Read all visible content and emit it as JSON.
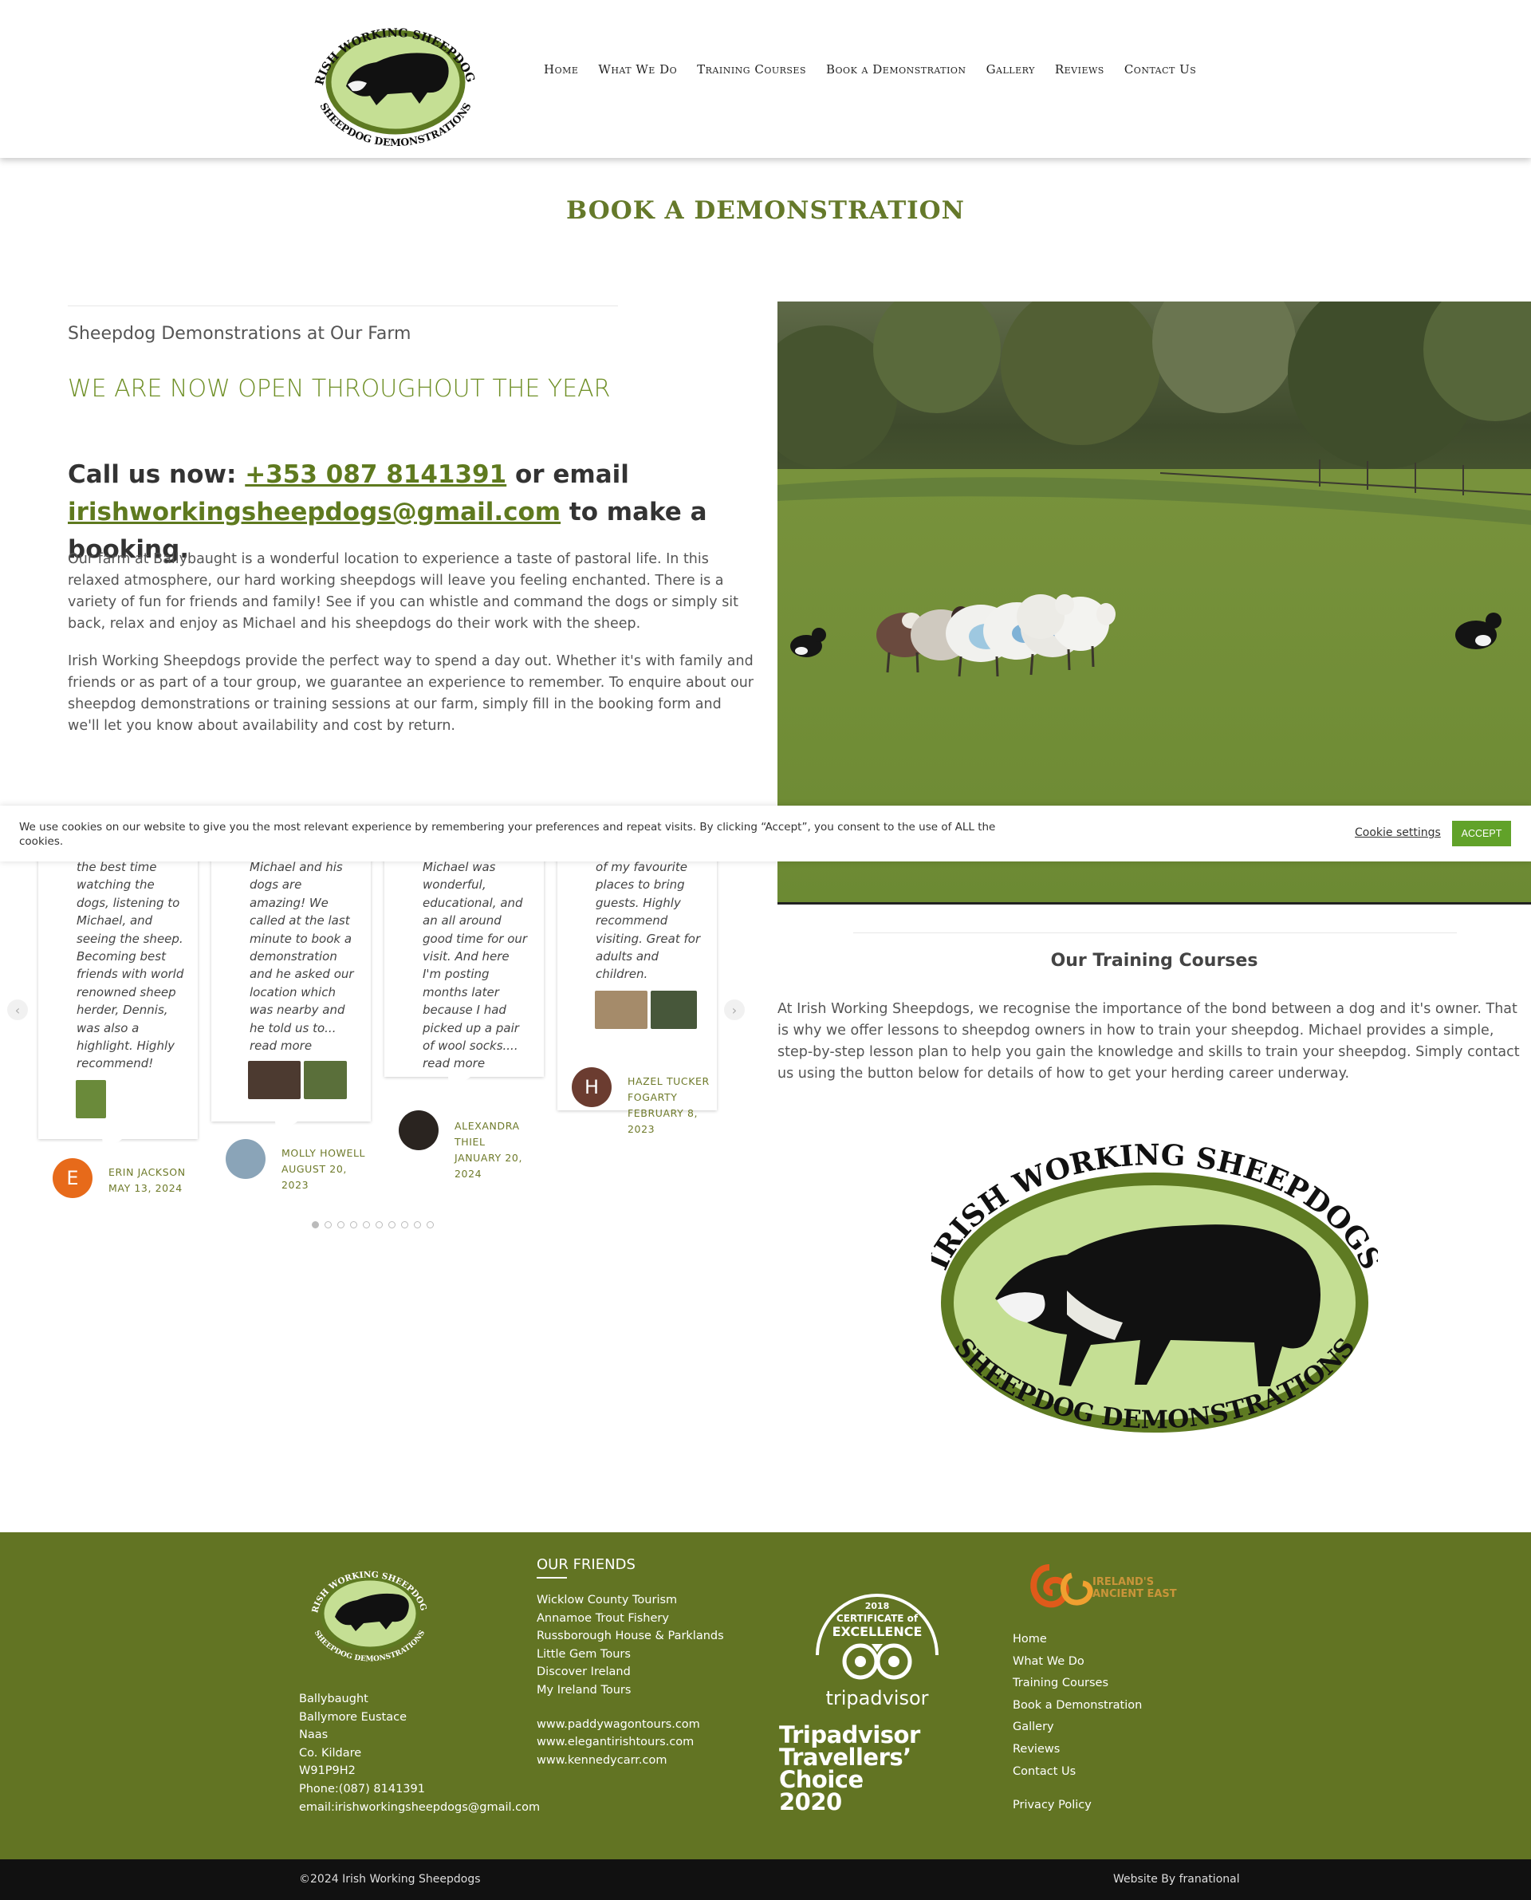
{
  "header": {
    "logo_top_text": "IRISH WORKING SHEEPDOGS",
    "logo_bottom_text": "SHEEPDOG DEMONSTRATIONS",
    "nav": [
      "Home",
      "What We Do",
      "Training Courses",
      "Book a Demonstration",
      "Gallery",
      "Reviews",
      "Contact Us"
    ]
  },
  "page_title": "BOOK A DEMONSTRATION",
  "intro": {
    "subhead": "Sheepdog Demonstrations at Our Farm",
    "open_banner": "WE ARE NOW OPEN THROUGHOUT THE YEAR",
    "call_prefix": "Call us now: ",
    "phone": "+353 087 8141391",
    "call_middle": " or email ",
    "email": "irishworkingsheepdogs@gmail.com",
    "call_suffix": " to make a booking.",
    "para1": "Our farm at Ballybaught is a wonderful location to experience a taste of pastoral life. In this relaxed atmosphere, our hard working sheepdogs will leave you feeling enchanted. There is a variety of fun for friends and family! See if you can whistle and command the dogs or simply sit back, relax and enjoy as Michael and his sheepdogs do their work with the sheep.",
    "para2": "Irish Working Sheepdogs provide the perfect way to spend a day out. Whether it's with family and friends or as part of a tour group, we guarantee an experience to remember. To enquire about our sheepdog demonstrations or training sessions at our farm, simply fill in the booking form and we'll let you know about availability and cost by return."
  },
  "cookie": {
    "text": "We use cookies on our website to give you the most relevant experience by remembering your preferences and repeat visits. By clicking “Accept”, you consent to the use of ALL the cookies.",
    "settings_label": "Cookie settings",
    "accept_label": "ACCEPT"
  },
  "reviews": [
    {
      "text": [
        "the best time",
        "watching the",
        "dogs, listening to",
        "Michael, and",
        "seeing the sheep.",
        "Becoming best",
        "friends with world",
        "renowned sheep",
        "herder, Dennis,",
        "was also a",
        "highlight. Highly",
        "recommend!"
      ],
      "initial": "E",
      "name": "ERIN JACKSON",
      "date": "MAY 13, 2024"
    },
    {
      "text": [
        "Michael and his",
        "dogs are",
        "amazing! We",
        "called at the last",
        "minute to book a",
        "demonstration",
        "and he asked our",
        "location which",
        "was nearby and",
        "he told us to...",
        "read more"
      ],
      "name": "MOLLY HOWELL",
      "date": "AUGUST 20, 2023"
    },
    {
      "text": [
        "Michael was",
        "wonderful,",
        "educational, and",
        "an all around",
        "good time for our",
        "visit. And here",
        "I'm posting",
        "months later",
        "because I had",
        "picked up a pair",
        "of wool socks....",
        "read more"
      ],
      "name": "ALEXANDRA THIEL",
      "date": "JANUARY 20, 2024"
    },
    {
      "text": [
        "of my favourite",
        "places to bring",
        "guests. Highly",
        "recommend",
        "visiting. Great for",
        "adults and",
        "children."
      ],
      "initial": "H",
      "name": "HAZEL TUCKER FOGARTY",
      "date": "FEBRUARY 8, 2023"
    }
  ],
  "carousel": {
    "prev_icon": "‹",
    "next_icon": "›",
    "dot_count": 10,
    "active_dot": 0
  },
  "training": {
    "title": "Our Training Courses",
    "text": "At Irish Working Sheepdogs, we recognise the importance of the bond between a dog and it's owner. That is why we offer lessons to sheepdog owners in how to train your sheepdog. Michael provides a simple, step-by-step lesson plan to help you gain the knowledge and skills to train your sheepdog. Simply contact us using the button below for details of how to get your herding career underway."
  },
  "footer": {
    "address": [
      "Ballybaught",
      "Ballymore Eustace",
      "Naas",
      "Co. Kildare",
      "W91P9H2",
      "Phone:(087) 8141391",
      "email:irishworkingsheepdogs@gmail.com"
    ],
    "friends_title": "OUR FRIENDS",
    "friends": [
      "Wicklow County Tourism",
      "Annamoe Trout Fishery",
      "Russborough House & Parklands",
      "Little Gem Tours",
      "Discover Ireland",
      "My Ireland Tours"
    ],
    "friend_urls": [
      "www.paddywagontours.com",
      "www.elegantirishtours.com",
      "www.kennedycarr.com"
    ],
    "trip_year": "2018",
    "trip_cert_line1": "CERTIFICATE of",
    "trip_cert_line2": "EXCELLENCE",
    "trip_brand": "tripadvisor",
    "travellers": [
      "Tripadvisor",
      "Travellers’",
      "Choice",
      "2020"
    ],
    "ancient_line1": "IRELAND'S",
    "ancient_line2": "ANCIENT EAST",
    "links": [
      "Home",
      "What We Do",
      "Training Courses",
      "Book a Demonstration",
      "Gallery",
      "Reviews",
      "Contact Us"
    ],
    "privacy": "Privacy Policy",
    "copyright": "©2024 Irish Working Sheepdogs",
    "credit": "Website By franational"
  },
  "colors": {
    "brand_green": "#627423",
    "heading_green": "#65792a",
    "accept_green": "#61a229",
    "logo_fill": "#c5df94"
  }
}
